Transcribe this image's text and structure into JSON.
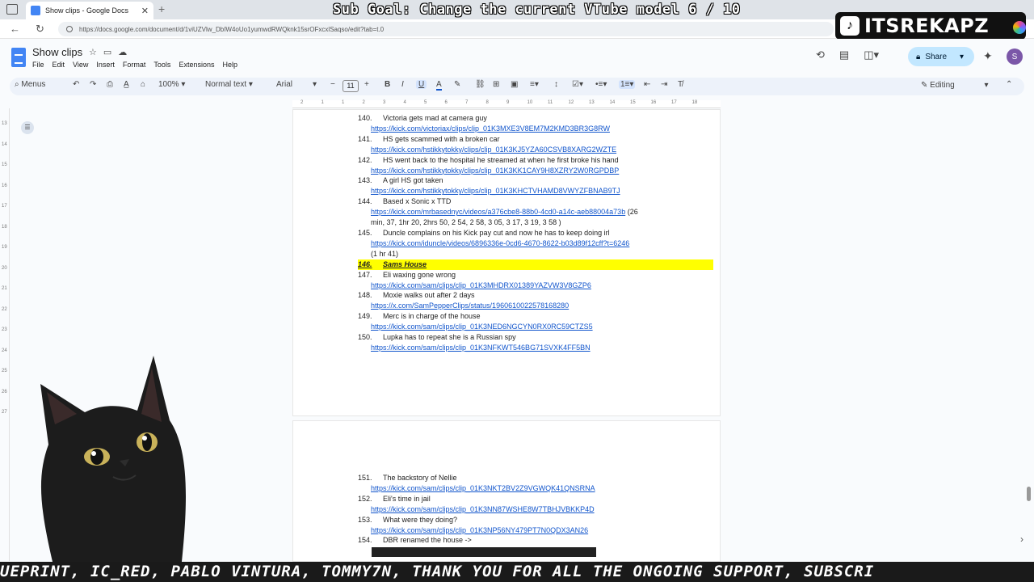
{
  "browser": {
    "tab_title": "Show clips - Google Docs",
    "url": "https://docs.google.com/document/d/1viUZVlw_DbIW4oUo1yumwdRWQknk15srOFxcxlSaqso/edit?tab=t.0"
  },
  "overlay": {
    "sub_goal": "Sub Goal: Change the current VTube model  6 / 10",
    "tiktok_name": "ITSREKAPZ",
    "ticker": "UEPRINT, IC_RED, PABLO VINTURA, TOMMY7N, THANK YOU FOR ALL THE ONGOING SUPPORT, SUBSCRI"
  },
  "docs": {
    "title": "Show clips",
    "menu": [
      "File",
      "Edit",
      "View",
      "Insert",
      "Format",
      "Tools",
      "Extensions",
      "Help"
    ],
    "share_label": "Share",
    "avatar_letter": "S",
    "toolbar": {
      "menus_label": "Menus",
      "zoom": "100%",
      "style": "Normal text",
      "font": "Arial",
      "font_size": "11",
      "mode": "Editing"
    }
  },
  "ruler": {
    "h_ticks": [
      "2",
      "1",
      "1",
      "2",
      "3",
      "4",
      "5",
      "6",
      "7",
      "8",
      "9",
      "10",
      "11",
      "12",
      "13",
      "14",
      "15",
      "16",
      "17",
      "18"
    ],
    "v_ticks": [
      "13",
      "14",
      "15",
      "16",
      "17",
      "18",
      "19",
      "20",
      "21",
      "22",
      "23",
      "24",
      "25",
      "26",
      "27"
    ]
  },
  "document": {
    "page1": [
      {
        "num": "140.",
        "title": "Victoria gets mad at camera guy",
        "link": "https://kick.com/victoriax/clips/clip_01K3MXE3V8EM7M2KMD3BR3G8RW"
      },
      {
        "num": "141.",
        "title": "HS gets scammed with a broken car",
        "link": "https://kick.com/hstikkytokky/clips/clip_01K3KJ5YZA60CSVB8XARG2WZTE"
      },
      {
        "num": "142.",
        "title": "HS went back to the hospital he streamed at when he first broke his hand",
        "link": "https://kick.com/hstikkytokky/clips/clip_01K3KK1CAY9H8XZRY2W0RGPDBP"
      },
      {
        "num": "143.",
        "title": "A girl HS got taken",
        "link": "https://kick.com/hstikkytokky/clips/clip_01K3KHCTVHAMD8VWYZFBNAB9TJ"
      },
      {
        "num": "144.",
        "title": "Based x Sonic x TTD",
        "link": "https://kick.com/mrbasednyc/videos/a376cbe8-88b0-4cd0-a14c-aeb88004a73b",
        "inline_note": " (26",
        "note": "min, 37, 1hr 20, 2hrs 50, 2 54, 2 58, 3 05, 3 17, 3 19, 3 58 )"
      },
      {
        "num": "145.",
        "title": "Duncle complains on his Kick pay cut and now he has to keep doing irl",
        "link": "https://kick.com/iduncle/videos/6896336e-0cd6-4670-8622-b03d89f12cff?t=6246",
        "note": "(1 hr 41)"
      },
      {
        "num": "146.",
        "title": "Sams House",
        "highlight": true
      },
      {
        "num": "147.",
        "title": "Eli waxing gone wrong",
        "link": "https://kick.com/sam/clips/clip_01K3MHDRX01389YAZVW3V8GZP6"
      },
      {
        "num": "148.",
        "title": "Moxie walks out after 2 days",
        "link": "https://x.com/SamPepperClips/status/1960610022578168280"
      },
      {
        "num": "149.",
        "title": "Merc is in charge of the house",
        "link": "https://kick.com/sam/clips/clip_01K3NED6NGCYN0RX0RC59CTZS5"
      },
      {
        "num": "150.",
        "title": "Lupka has to repeat she is a Russian spy",
        "link": "https://kick.com/sam/clips/clip_01K3NFKWT546BG71SVXK4FF5BN"
      }
    ],
    "page2": [
      {
        "num": "151.",
        "title": "The backstory of Nellie",
        "link": "https://kick.com/sam/clips/clip_01K3NKT2BV2Z9VGWQK41QNSRNA"
      },
      {
        "num": "152.",
        "title": "Eli's time in jail",
        "link": "https://kick.com/sam/clips/clip_01K3NN87WSHE8W7TBHJVBKKP4D"
      },
      {
        "num": "153.",
        "title": "What were they doing?",
        "link": "https://kick.com/sam/clips/clip_01K3NP56NY479PT7N0QDX3AN26"
      },
      {
        "num": "154.",
        "title": "DBR renamed the house ->"
      }
    ]
  },
  "colors": {
    "link": "#1155cc",
    "highlight": "#ffff00",
    "share_bg": "#c2e7ff",
    "docs_blue": "#4285f4"
  }
}
